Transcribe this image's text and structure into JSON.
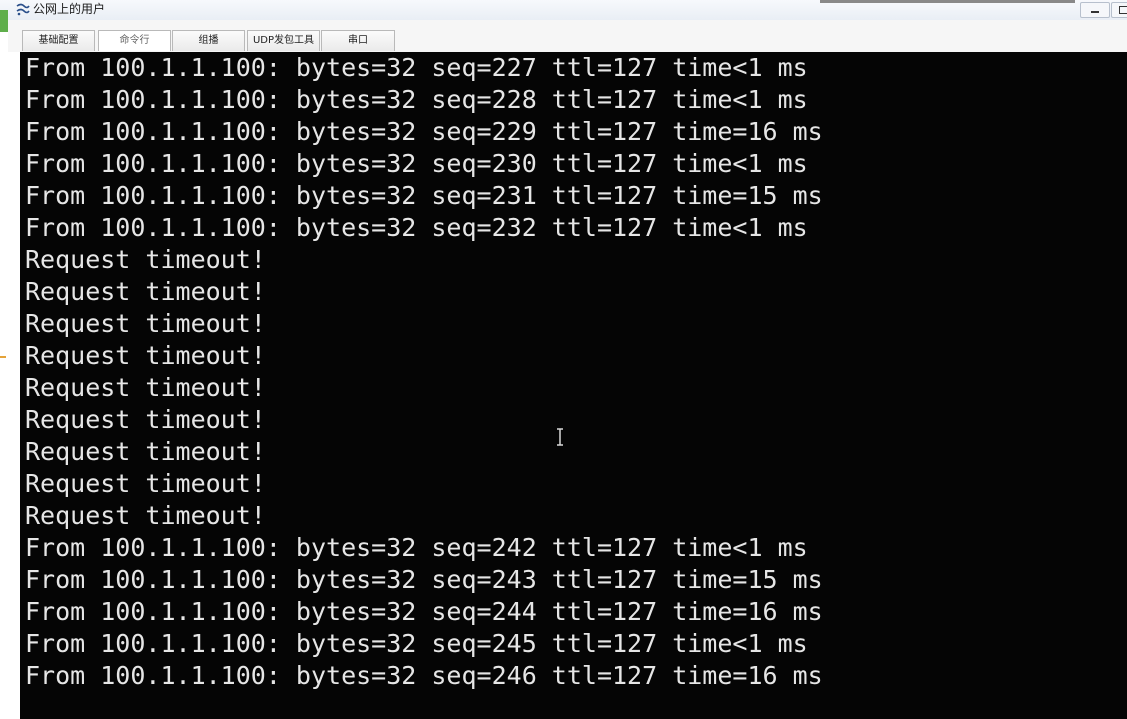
{
  "window": {
    "title": "公网上的用户",
    "icon": "app-network-icon"
  },
  "tabs": [
    {
      "label": "基础配置"
    },
    {
      "label": "命令行"
    },
    {
      "label": "组播"
    },
    {
      "label": "UDP发包工具"
    },
    {
      "label": "串口"
    }
  ],
  "active_tab": "命令行",
  "console": {
    "lines": [
      "From 100.1.1.100: bytes=32 seq=227 ttl=127 time<1 ms",
      "From 100.1.1.100: bytes=32 seq=228 ttl=127 time<1 ms",
      "From 100.1.1.100: bytes=32 seq=229 ttl=127 time=16 ms",
      "From 100.1.1.100: bytes=32 seq=230 ttl=127 time<1 ms",
      "From 100.1.1.100: bytes=32 seq=231 ttl=127 time=15 ms",
      "From 100.1.1.100: bytes=32 seq=232 ttl=127 time<1 ms",
      "Request timeout!",
      "Request timeout!",
      "Request timeout!",
      "Request timeout!",
      "Request timeout!",
      "Request timeout!",
      "Request timeout!",
      "Request timeout!",
      "Request timeout!",
      "From 100.1.1.100: bytes=32 seq=242 ttl=127 time<1 ms",
      "From 100.1.1.100: bytes=32 seq=243 ttl=127 time=15 ms",
      "From 100.1.1.100: bytes=32 seq=244 ttl=127 time=16 ms",
      "From 100.1.1.100: bytes=32 seq=245 ttl=127 time<1 ms",
      "From 100.1.1.100: bytes=32 seq=246 ttl=127 time=16 ms"
    ],
    "background_color": "#050505",
    "text_color": "#e6e6e6"
  },
  "cursor": "text-cursor-icon"
}
